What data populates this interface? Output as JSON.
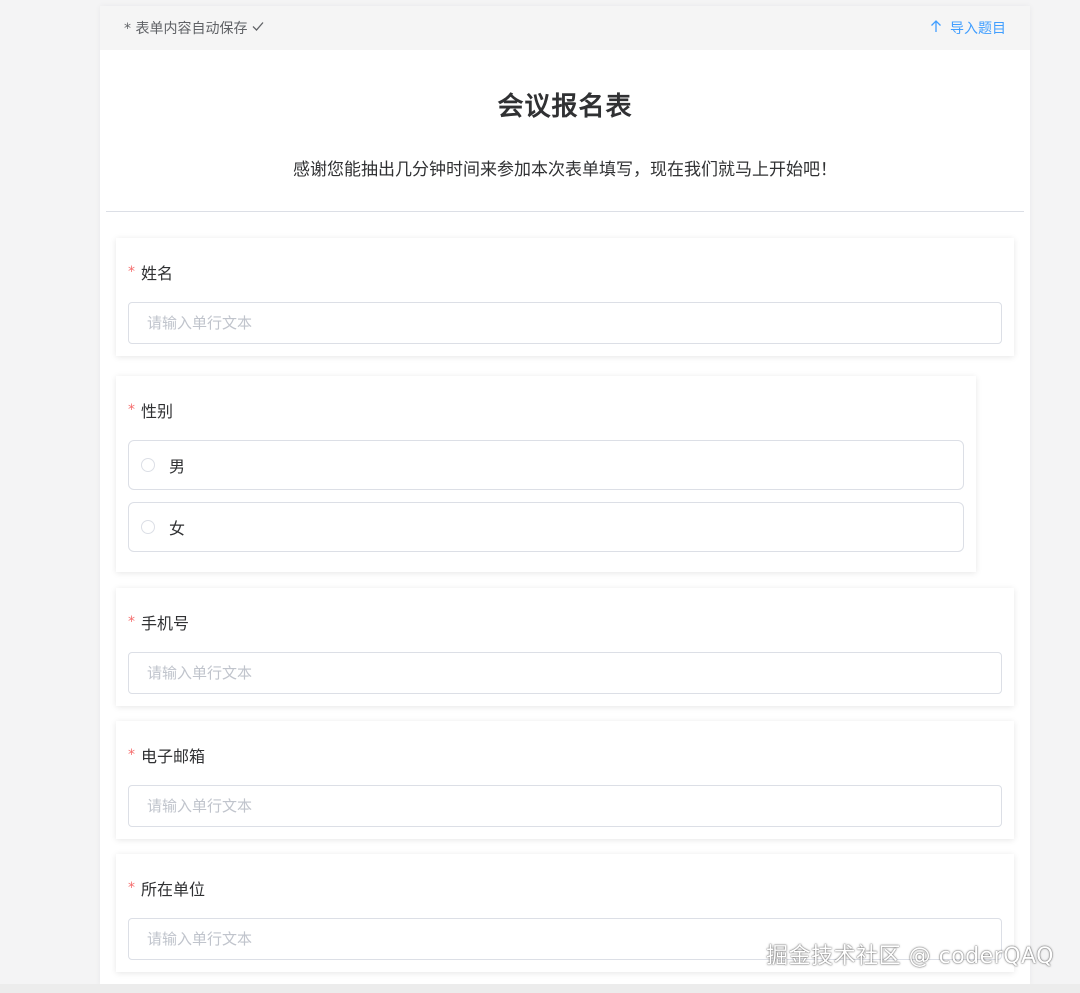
{
  "topbar": {
    "save_status": "* 表单内容自动保存",
    "import_label": "导入题目"
  },
  "header": {
    "title": "会议报名表",
    "description": "感谢您能抽出几分钟时间来参加本次表单填写，现在我们就马上开始吧！"
  },
  "questions": {
    "name": {
      "required_mark": "*",
      "label": "姓名",
      "placeholder": "请输入单行文本"
    },
    "gender": {
      "required_mark": "*",
      "label": "性别",
      "options": [
        "男",
        "女"
      ]
    },
    "phone": {
      "required_mark": "*",
      "label": "手机号",
      "placeholder": "请输入单行文本"
    },
    "email": {
      "required_mark": "*",
      "label": "电子邮箱",
      "placeholder": "请输入单行文本"
    },
    "company": {
      "required_mark": "*",
      "label": "所在单位",
      "placeholder": "请输入单行文本"
    }
  },
  "watermark": "掘金技术社区 @ coderQAQ",
  "colors": {
    "accent": "#409eff",
    "required": "#f56c6c",
    "border": "#dcdfe6",
    "placeholder": "#c0c4cc"
  },
  "icons": {
    "save_status": "check-icon",
    "import": "arrow-up-icon",
    "radio": "radio-circle-icon"
  }
}
